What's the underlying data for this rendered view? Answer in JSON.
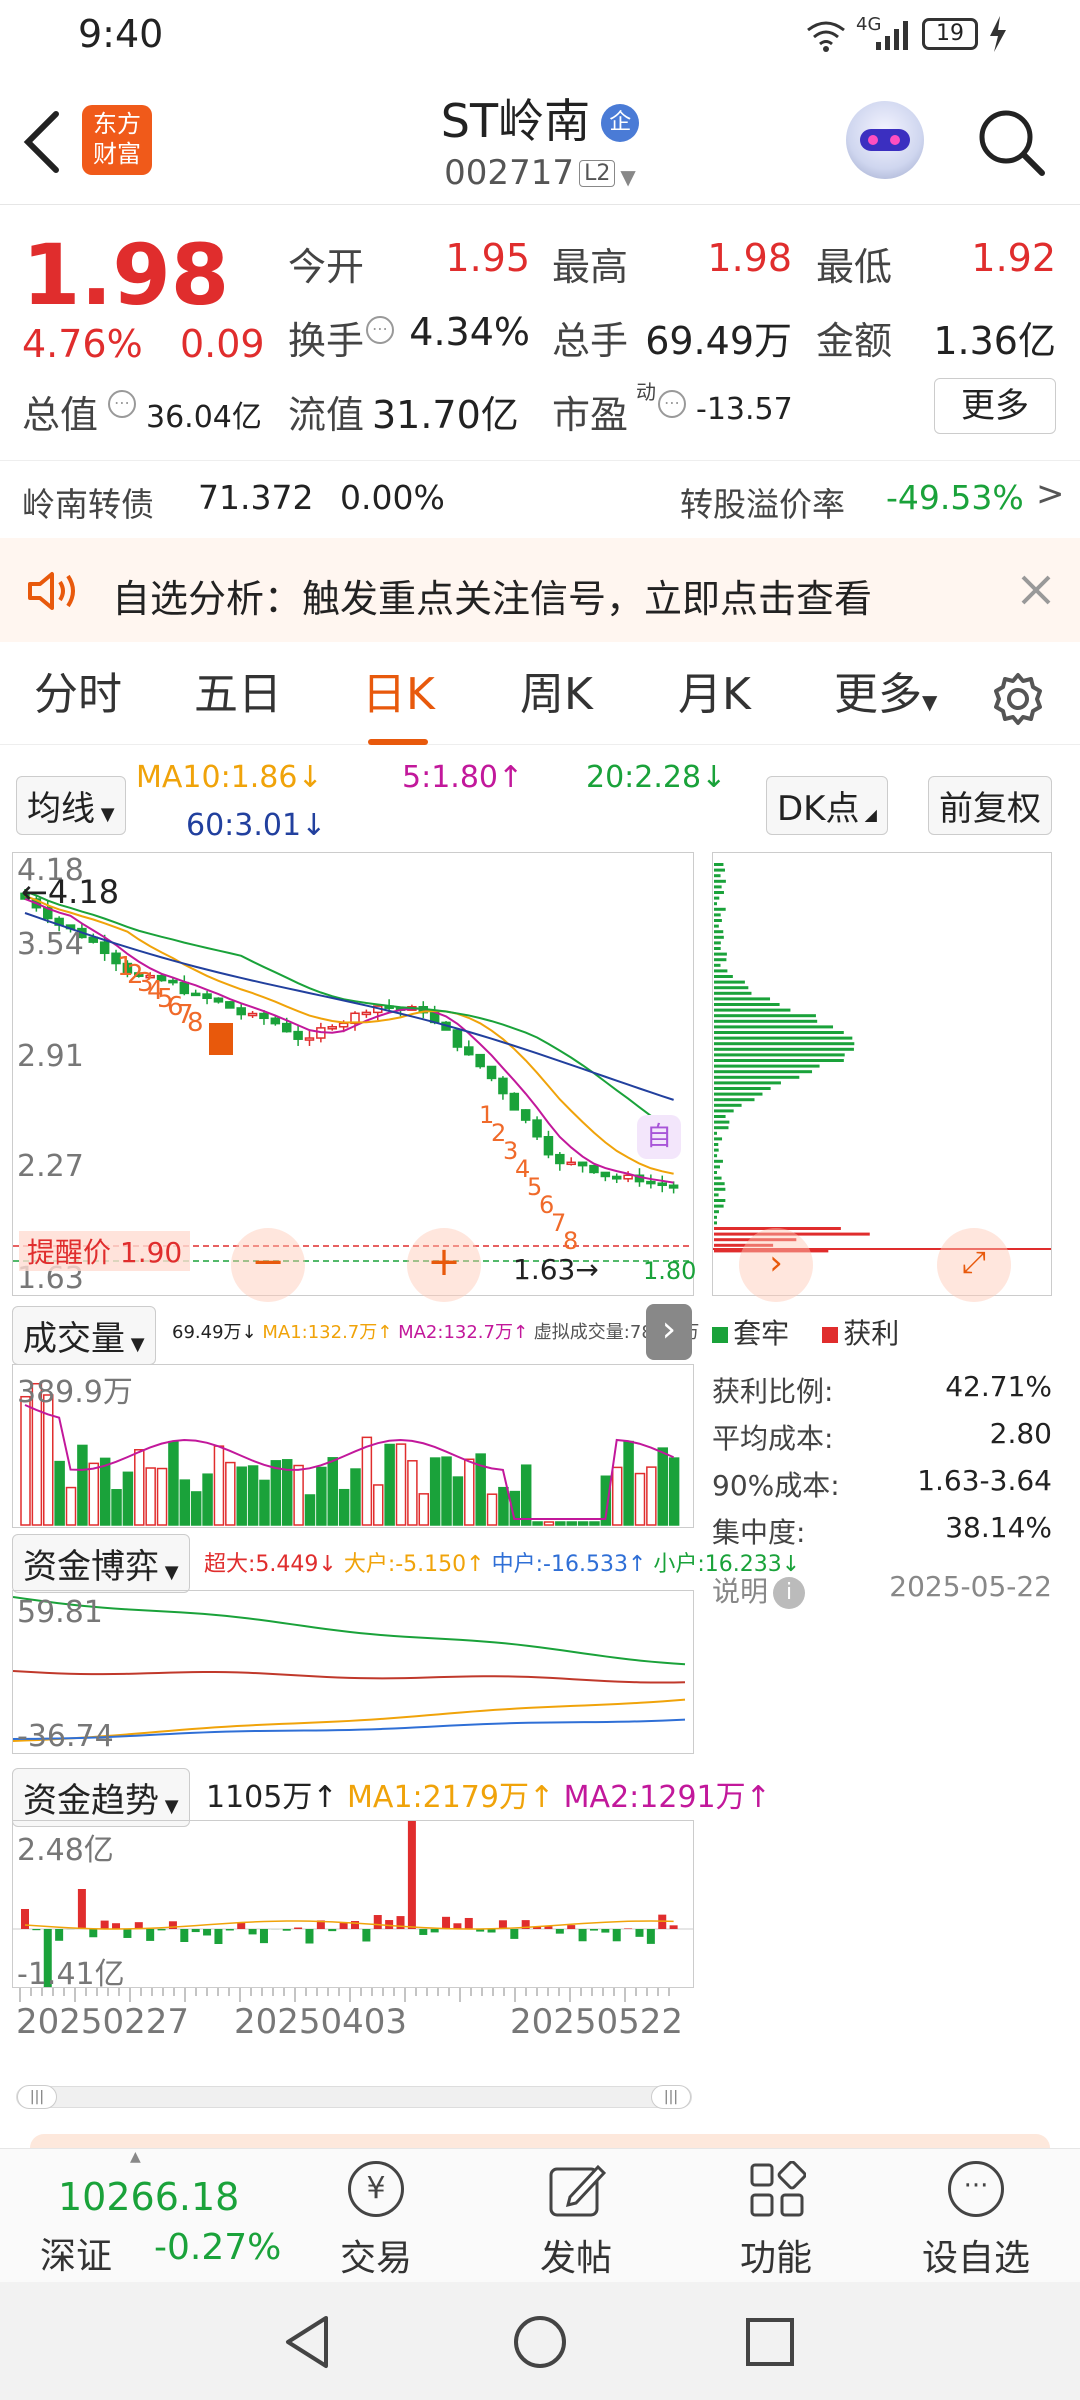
{
  "status_bar": {
    "time": "9:40",
    "signal": "4G",
    "battery": "19"
  },
  "header": {
    "back_icon": "chevron-left-icon",
    "logo": {
      "line1": "东方",
      "line2": "财富"
    },
    "title": "ST岭南",
    "badge": "企",
    "code": "002717",
    "level": "L2"
  },
  "quote": {
    "price": "1.98",
    "change_pct": "4.76%",
    "change": "0.09",
    "open_label": "今开",
    "open": "1.95",
    "high_label": "最高",
    "high": "1.98",
    "low_label": "最低",
    "low": "1.92",
    "turnover_label": "换手",
    "turnover": "4.34%",
    "volume_label": "总手",
    "volume": "69.49万",
    "amount_label": "金额",
    "amount": "1.36亿",
    "mktcap_label": "总值",
    "mktcap": "36.04亿",
    "float_label": "流值",
    "float": "31.70亿",
    "pe_label": "市盈",
    "pe_sup": "动",
    "pe": "-13.57",
    "more": "更多",
    "bond_name": "岭南转债",
    "bond_price": "71.372",
    "bond_change": "0.00%",
    "premium_label": "转股溢价率",
    "premium": "-49.53%"
  },
  "notice": {
    "text": "自选分析：触发重点关注信号，立即点击查看"
  },
  "tabs": [
    "分时",
    "五日",
    "日K",
    "周K",
    "月K",
    "更多"
  ],
  "ma_bar": {
    "ma_select": "均线",
    "ma10": "MA10:1.86↓",
    "ma5": "5:1.80↑",
    "ma20": "20:2.28↓",
    "ma60": "60:3.01↓",
    "dk": "DK点",
    "adjust": "前复权"
  },
  "kline": {
    "y_labels": [
      "4.18",
      "3.54",
      "2.91",
      "2.27",
      "1.63"
    ],
    "max_marker": "←4.18",
    "min_marker": "1.63→",
    "alert": "提醒价 1.90",
    "price_tag": "1.80",
    "self_tag": "自",
    "seq_first": [
      "1",
      "2",
      "3",
      "4",
      "5",
      "6",
      "7",
      "8",
      "9"
    ],
    "seq_second": [
      "1",
      "2",
      "3",
      "4",
      "5",
      "6",
      "7",
      "8"
    ],
    "colors": {
      "up": "#e02d2d",
      "down": "#1aa23a",
      "ma5": "#c2189b",
      "ma10": "#f0a30a",
      "ma20": "#1aa23a",
      "ma60": "#22409e"
    }
  },
  "volume": {
    "select": "成交量",
    "stats": "69.49万↓",
    "ma1": "MA1:132.7万↑",
    "ma2": "MA2:132.7万↑",
    "virtual": "虚拟成交量:78.62万",
    "y_top": "389.9万"
  },
  "capital_game": {
    "select": "资金博弈",
    "super": "超大:5.449↓",
    "big": "大户:-5.150↑",
    "mid": "中户:-16.533↑",
    "small": "小户:16.233↓",
    "y_top": "59.81",
    "y_bottom": "-36.74"
  },
  "capital_trend": {
    "select": "资金趋势",
    "value": "1105万↑",
    "ma1": "MA1:2179万↑",
    "ma2": "MA2:1291万↑",
    "y_top": "2.48亿",
    "y_bottom": "-1.41亿"
  },
  "x_axis": [
    "20250227",
    "20250403",
    "20250522"
  ],
  "chip": {
    "legend_trapped": "套牢",
    "legend_profit": "获利",
    "stats": [
      {
        "label": "获利比例:",
        "value": "42.71%"
      },
      {
        "label": "平均成本:",
        "value": "2.80"
      },
      {
        "label": "90%成本:",
        "value": "1.63-3.64"
      },
      {
        "label": "集中度:",
        "value": "38.14%"
      }
    ],
    "note_label": "说明",
    "date": "2025-05-22"
  },
  "bottom_nav": {
    "index_value": "10266.18",
    "index_name": "深证",
    "index_change": "-0.27%",
    "items": [
      "交易",
      "发帖",
      "功能",
      "设自选"
    ]
  }
}
